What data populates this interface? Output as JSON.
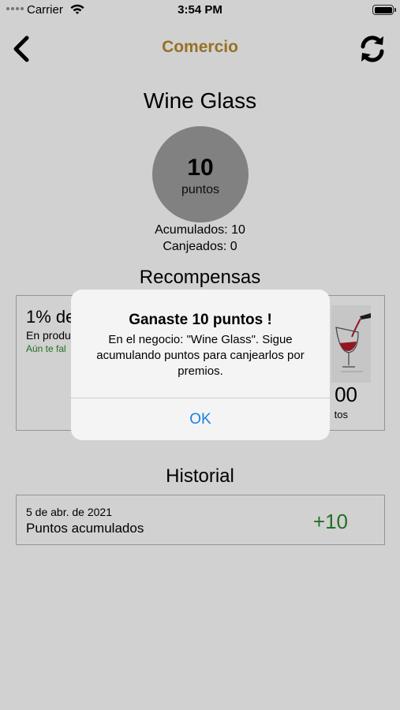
{
  "status_bar": {
    "carrier": "Carrier",
    "time": "3:54 PM"
  },
  "nav": {
    "title": "Comercio",
    "back_icon": "chevron-left-icon",
    "refresh_icon": "refresh-icon"
  },
  "shop": {
    "name": "Wine Glass"
  },
  "points": {
    "value": "10",
    "unit": "puntos",
    "accumulated": "Acumulados: 10",
    "redeemed": "Canjeados: 0"
  },
  "rewards": {
    "title": "Recompensas",
    "items": [
      {
        "title": "1% de",
        "subtitle": "En produ",
        "needed": "Aún te fal",
        "cost": "00",
        "cost_unit": "tos"
      }
    ]
  },
  "history": {
    "title": "Historial",
    "entries": [
      {
        "date": "5 de abr. de 2021",
        "label": "Puntos acumulados",
        "points": "+10"
      }
    ]
  },
  "alert": {
    "title": "Ganaste 10 puntos !",
    "message": "En el negocio: \"Wine Glass\". Sigue acumulando puntos para canjearlos por premios.",
    "ok": "OK"
  },
  "colors": {
    "accent": "#b88a2e",
    "positive": "#2a8a2a",
    "alert_button": "#1a7fe6",
    "circle": "#9e9e9e"
  }
}
